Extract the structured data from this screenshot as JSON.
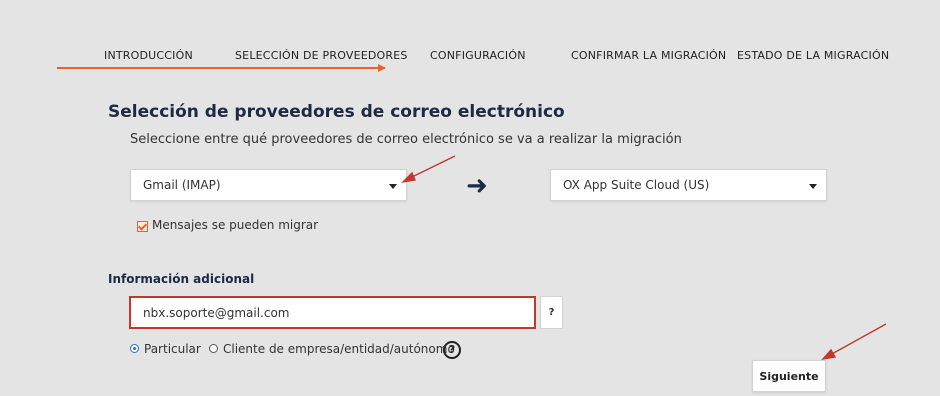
{
  "wizard": {
    "steps": [
      {
        "label": "INTRODUCCIÓN"
      },
      {
        "label": "SELECCIÓN DE PROVEEDORES"
      },
      {
        "label": "CONFIGURACIÓN"
      },
      {
        "label": "CONFIRMAR LA MIGRACIÓN"
      },
      {
        "label": "ESTADO DE LA MIGRACIÓN"
      }
    ],
    "active_step": 2,
    "accent_color": "#e8622a"
  },
  "main": {
    "title": "Selección de proveedores de correo electrónico",
    "subtitle": "Seleccione entre qué proveedores de correo electrónico se va a realizar la migración",
    "source_select": {
      "value": "Gmail (IMAP)"
    },
    "destination_select": {
      "value": "OX App Suite Cloud (US)"
    },
    "migrate_checkbox": {
      "label": "Mensajes se pueden migrar",
      "checked": true
    }
  },
  "additional_info": {
    "heading": "Información adicional",
    "email_input": {
      "value": "nbx.soporte@gmail.com"
    },
    "help_label": "?",
    "account_type": {
      "options": [
        {
          "label": "Particular",
          "selected": true
        },
        {
          "label": "Cliente de empresa/entidad/autónomo",
          "selected": false
        }
      ]
    },
    "info_icon": "?"
  },
  "footer": {
    "next_label": "Siguiente"
  },
  "annotation_color": "#c0392b"
}
